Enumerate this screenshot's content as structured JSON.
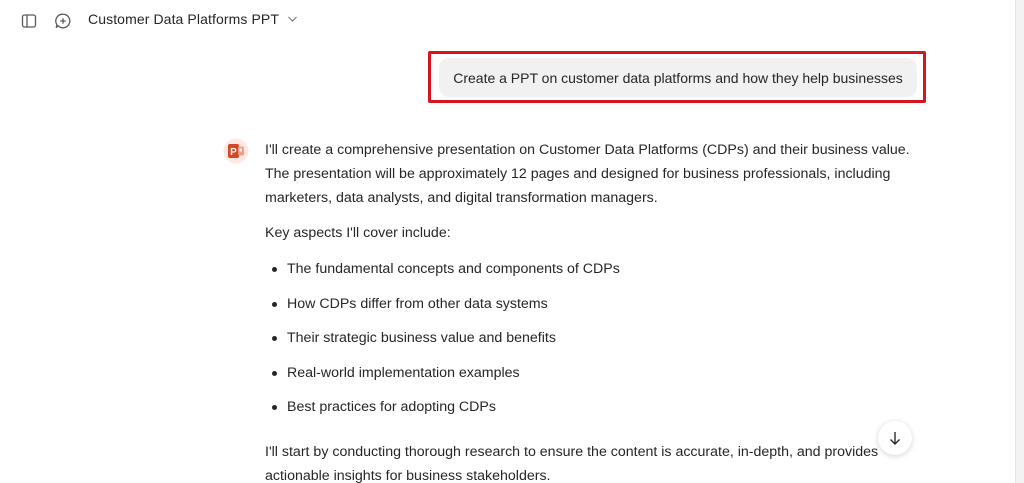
{
  "header": {
    "title": "Customer Data Platforms PPT",
    "icons": [
      "sidebar-toggle-icon",
      "new-chat-icon",
      "chevron-down-icon"
    ]
  },
  "user_message": {
    "text": "Create a PPT on customer data platforms and how they help businesses",
    "highlight_color": "#d6151f"
  },
  "assistant": {
    "avatar_icon": "powerpoint-icon",
    "accent_color": "#d24726",
    "intro": "I'll create a comprehensive presentation on Customer Data Platforms (CDPs) and their business value. The presentation will be approximately 12 pages and designed for business professionals, including marketers, data analysts, and digital transformation managers.",
    "key_aspects_heading": "Key aspects I'll cover include:",
    "bullets": [
      "The fundamental concepts and components of CDPs",
      "How CDPs differ from other data systems",
      "Their strategic business value and benefits",
      "Real-world implementation examples",
      "Best practices for adopting CDPs"
    ],
    "closing": "I'll start by conducting thorough research to ensure the content is accurate, in-depth, and provides actionable insights for business stakeholders."
  },
  "scroll_button": {
    "icon": "arrow-down-icon"
  }
}
